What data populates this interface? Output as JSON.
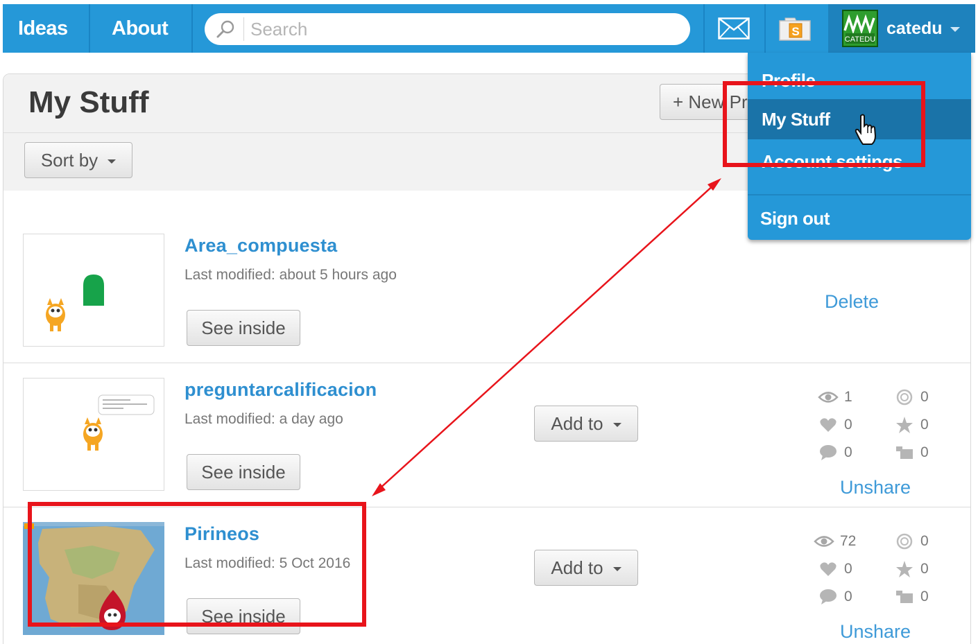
{
  "nav": {
    "ideas": "Ideas",
    "about": "About",
    "search_placeholder": "Search",
    "username": "catedu",
    "avatar_text": "CATEDU",
    "icons": [
      "messages-icon",
      "my-stuff-folder-icon",
      "chevron-down-icon"
    ]
  },
  "dropdown": {
    "profile": "Profile",
    "my_stuff": "My Stuff",
    "account_settings": "Account settings",
    "sign_out": "Sign out"
  },
  "page": {
    "title": "My Stuff",
    "new_project": "+ New Project",
    "sort_by": "Sort by"
  },
  "projects": [
    {
      "title": "Area_compuesta",
      "modified": "Last modified: about 5 hours ago",
      "see_inside": "See inside",
      "action": "Delete",
      "shared": false
    },
    {
      "title": "preguntarcalificacion",
      "modified": "Last modified: a day ago",
      "see_inside": "See inside",
      "add_to": "Add to",
      "stats": {
        "views": "1",
        "remixes": "0",
        "loves": "0",
        "favorites": "0",
        "comments": "0",
        "studios": "0"
      },
      "unshare": "Unshare",
      "shared": true
    },
    {
      "title": "Pirineos",
      "modified": "Last modified: 5 Oct 2016",
      "see_inside": "See inside",
      "add_to": "Add to",
      "stats": {
        "views": "72",
        "remixes": "0",
        "loves": "0",
        "favorites": "0",
        "comments": "0",
        "studios": "0"
      },
      "unshare": "Unshare",
      "shared": true
    }
  ],
  "colors": {
    "nav_blue": "#2598d8",
    "link_blue": "#2e8fd0",
    "annotation_red": "#e8141b"
  }
}
